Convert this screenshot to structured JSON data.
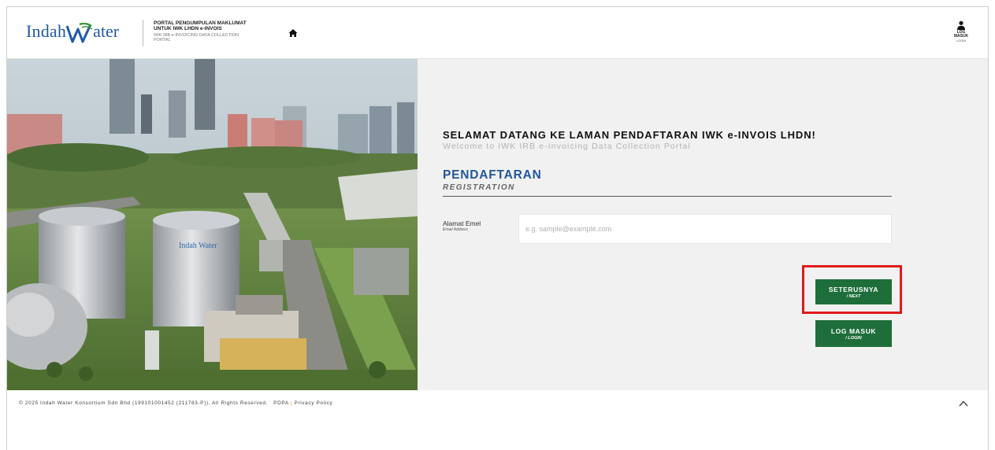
{
  "header": {
    "logo": {
      "part1": "Indah",
      "part2": "ater"
    },
    "portal_title": "PORTAL PENGUMPULAN MAKLUMAT UNTUK IWK LHDN e-INVOIS",
    "portal_subtitle": "IWK IRB e-INVOICING DATA COLLECTION PORTAL",
    "home_icon": "home-icon",
    "login_label": "LOG MASUK",
    "login_sublabel": "LOGIN",
    "login_icon": "user-icon"
  },
  "hero": {
    "image": "aerial view of Indah Water sewage treatment plant with city skyline"
  },
  "main": {
    "welcome": "SELAMAT DATANG KE LAMAN PENDAFTARAN IWK e-INVOIS LHDN!",
    "welcome_sub": "Welcome to IWK IRB e-Invoicing Data Collection Portal",
    "section_title": "PENDAFTARAN",
    "section_subtitle": "REGISTRATION",
    "email_label": "Alamat Emel",
    "email_sublabel": "Email Address",
    "email_placeholder": "e.g. sample@example.com",
    "email_value": "",
    "next_button": {
      "label": "SETERUSNYA",
      "sublabel": "/ NEXT"
    },
    "login_button": {
      "label": "LOG MASUK",
      "sublabel": "/ LOGIN"
    }
  },
  "footer": {
    "copyright": "© 2025 Indah Water Konsortium Sdn Bhd (199101001452 (211763-P)). All Rights Reserved.",
    "pdpa_link": "PDPA",
    "separator": "|",
    "privacy_link": "Privacy Policy",
    "scroll_top_icon": "chevron-up-icon"
  },
  "colors": {
    "brand_blue": "#1f5aa6",
    "button_green": "#1e6e3a",
    "highlight_red": "#e01a1a",
    "panel_gray": "#f1f1f1"
  }
}
